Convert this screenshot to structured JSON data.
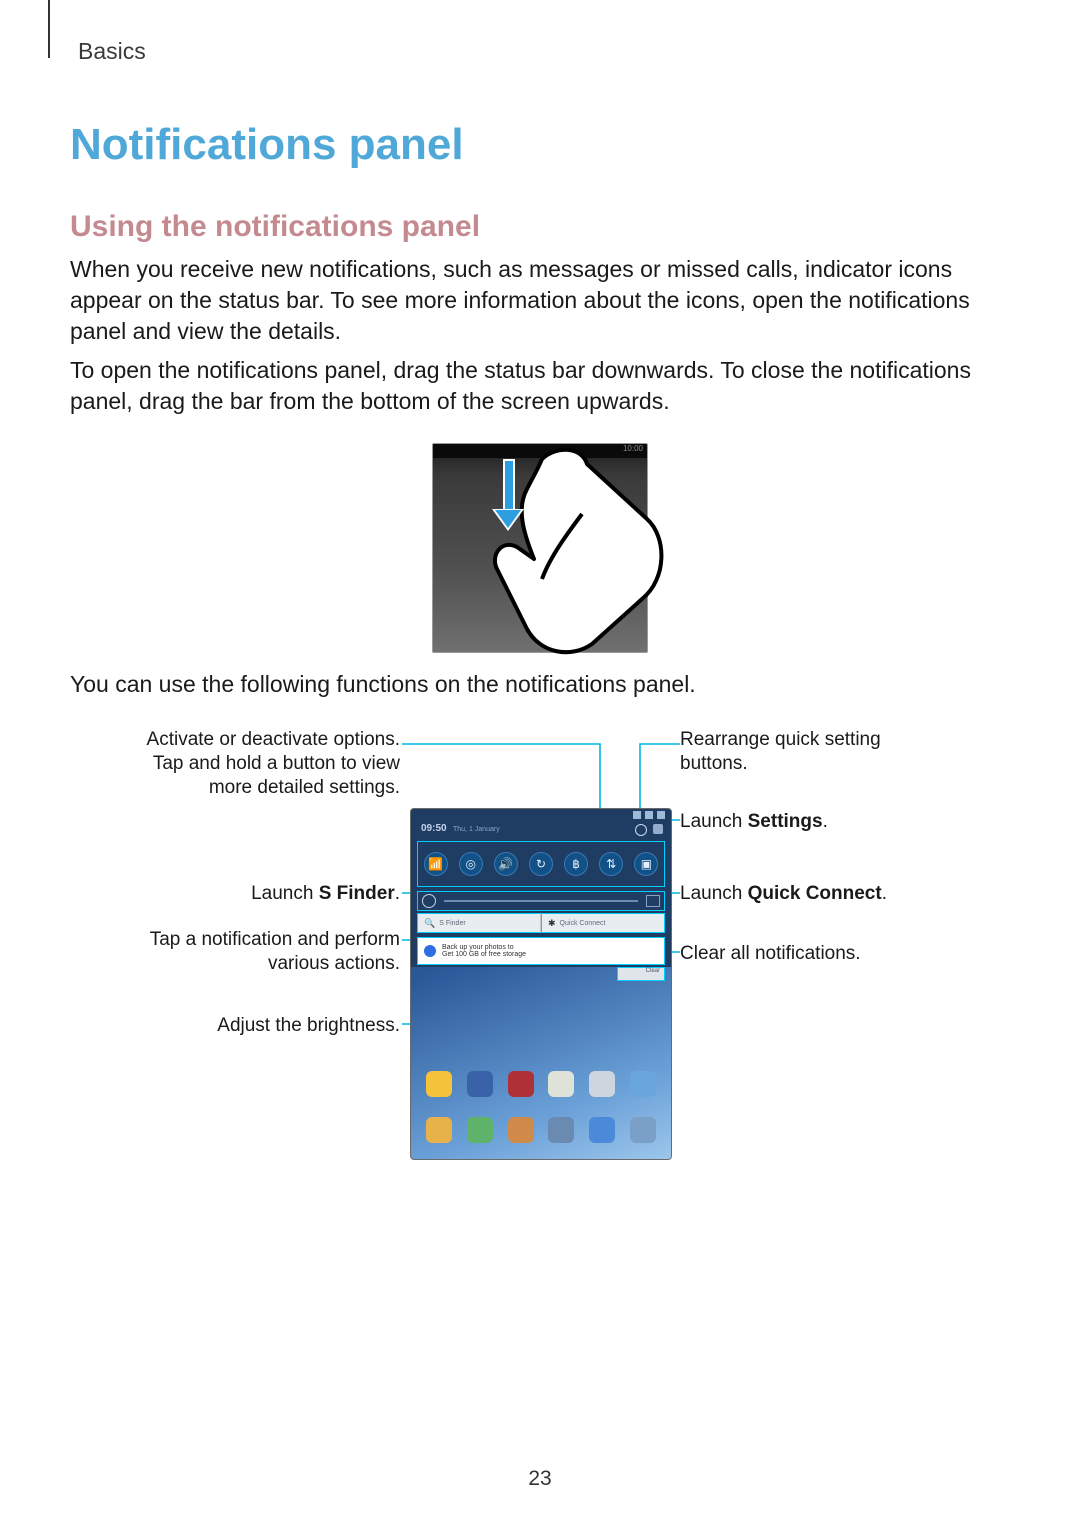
{
  "breadcrumb": "Basics",
  "h1": "Notifications panel",
  "h2": "Using the notifications panel",
  "p1": "When you receive new notifications, such as messages or missed calls, indicator icons appear on the status bar. To see more information about the icons, open the notifications panel and view the details.",
  "p2": "To open the notifications panel, drag the status bar downwards. To close the notifications panel, drag the bar from the bottom of the screen upwards.",
  "p3": "You can use the following functions on the notifications panel.",
  "fig1": {
    "status_time": "10:00"
  },
  "fig2": {
    "panel_time": "09:50",
    "panel_date": "Thu, 1 January",
    "sfinder_label": "S Finder",
    "quickconnect_label": "Quick Connect",
    "notif_title": "Back up your photos to",
    "notif_sub": "Get 100 GB of free storage",
    "clear_label": "Clear"
  },
  "callouts": {
    "left1_a": "Activate or deactivate options.",
    "left1_b": "Tap and hold a button to view",
    "left1_c": "more detailed settings.",
    "left2_a": "Launch ",
    "left2_b": "S Finder",
    "left2_c": ".",
    "left3_a": "Tap a notification and perform",
    "left3_b": "various actions.",
    "left4": "Adjust the brightness.",
    "right1_a": "Rearrange quick setting",
    "right1_b": "buttons.",
    "right2_a": "Launch ",
    "right2_b": "Settings",
    "right2_c": ".",
    "right3_a": "Launch ",
    "right3_b": "Quick Connect",
    "right3_c": ".",
    "right4": "Clear all notifications."
  },
  "page_number": "23"
}
